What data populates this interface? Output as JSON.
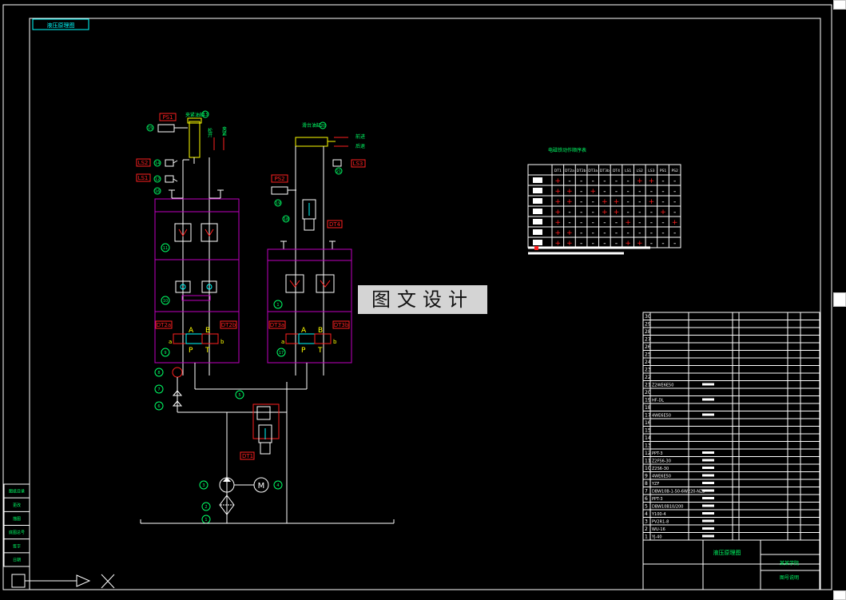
{
  "title_box": "液压原理图",
  "cylinders": {
    "left_title": "夹紧油缸",
    "right_title": "滑台油缸",
    "left_dir_labels": [
      "松开",
      "夹紧"
    ],
    "right_dir_labels": [
      "前进",
      "后退"
    ]
  },
  "tags": {
    "ps1": "PS1",
    "ps2": "PS2",
    "ls1": "LS1",
    "ls2": "LS2",
    "ls3": "LS3",
    "dt1": "DT1",
    "dt2a": "DT2a",
    "dt2b": "DT2b",
    "dt3a": "DT3a",
    "dt3b": "DT3b",
    "dt4": "DT4"
  },
  "valve_ports": {
    "left": {
      "a": "A",
      "b": "B",
      "p": "P",
      "t": "T",
      "sa": "a",
      "sb": "b"
    },
    "right": {
      "a": "A",
      "b": "B",
      "p": "P",
      "t": "T",
      "sa": "a",
      "sb": "b"
    }
  },
  "callouts": {
    "n1": "1",
    "n2": "2",
    "n3": "3",
    "n4": "4",
    "n5": "5",
    "n6": "6",
    "n7": "7",
    "n8": "8",
    "n9": "9",
    "n10": "10",
    "n11": "11",
    "n12": "12",
    "n13": "13",
    "n14": "14",
    "n15": "15",
    "n16": "16",
    "n17": "17",
    "n18": "18",
    "n19": "19",
    "n20": "20",
    "n21": "21"
  },
  "motor_symbol": "M",
  "action_table": {
    "title": "电磁铁动作顺序表",
    "headers": [
      "DT1",
      "DT2a",
      "DT2b",
      "DT3a",
      "DT3b",
      "DT4",
      "LS1",
      "LS2",
      "LS3",
      "PS1",
      "PS2"
    ],
    "rows": [
      [
        "+",
        "-",
        "-",
        "-",
        "-",
        "-",
        "-",
        "+",
        "+",
        "-",
        "-"
      ],
      [
        "+",
        "+",
        "-",
        "+",
        "-",
        "-",
        "-",
        "-",
        "-",
        "-",
        "-"
      ],
      [
        "+",
        "+",
        "-",
        "-",
        "+",
        "+",
        "-",
        "-",
        "+",
        "-",
        "-"
      ],
      [
        "+",
        "-",
        "-",
        "-",
        "+",
        "+",
        "-",
        "-",
        "-",
        "+",
        "-"
      ],
      [
        "+",
        "-",
        "-",
        "-",
        "-",
        "-",
        "+",
        "-",
        "-",
        "-",
        "+"
      ],
      [
        "+",
        "+",
        "-",
        "-",
        "-",
        "-",
        "-",
        "-",
        "-",
        "-",
        "-"
      ],
      [
        "+",
        "+",
        "-",
        "-",
        "-",
        "-",
        "+",
        "+",
        "-",
        "-",
        "-"
      ]
    ]
  },
  "watermark": "图文设计",
  "bom": [
    {
      "n": "30",
      "name": ""
    },
    {
      "n": "29",
      "name": ""
    },
    {
      "n": "28",
      "name": ""
    },
    {
      "n": "27",
      "name": ""
    },
    {
      "n": "26",
      "name": ""
    },
    {
      "n": "25",
      "name": ""
    },
    {
      "n": "24",
      "name": ""
    },
    {
      "n": "23",
      "name": ""
    },
    {
      "n": "22",
      "name": ""
    },
    {
      "n": "21",
      "name": "Z2WE6E50"
    },
    {
      "n": "20",
      "name": ""
    },
    {
      "n": "19",
      "name": "HF-DL"
    },
    {
      "n": "18",
      "name": ""
    },
    {
      "n": "17",
      "name": "4WE6E50"
    },
    {
      "n": "16",
      "name": ""
    },
    {
      "n": "15",
      "name": ""
    },
    {
      "n": "14",
      "name": ""
    },
    {
      "n": "13",
      "name": ""
    },
    {
      "n": "12",
      "name": "PPT-3"
    },
    {
      "n": "11",
      "name": "Z2FS6-30"
    },
    {
      "n": "10",
      "name": "Z2S6-30"
    },
    {
      "n": "9",
      "name": "4WE6E50"
    },
    {
      "n": "8",
      "name": "YZF"
    },
    {
      "n": "7",
      "name": "DBW10B-1-50-6W220-NZ5"
    },
    {
      "n": "6",
      "name": "PPT-3"
    },
    {
      "n": "5",
      "name": "DBW10B10/200"
    },
    {
      "n": "4",
      "name": "Y100-4"
    },
    {
      "n": "3",
      "name": "PV2R1-8"
    },
    {
      "n": "2",
      "name": "WU-16"
    },
    {
      "n": "1",
      "name": "YJ-40"
    }
  ],
  "title_block": {
    "drawing_name": "液压原理图",
    "company": "某某学院",
    "sheet_code": "图号说明"
  },
  "side_strip": [
    "图纸目录",
    "更改",
    "描图",
    "底图总号",
    "签字",
    "日期"
  ],
  "colors": {
    "background": "#000000",
    "frame": "#ffffff",
    "valve_block": "#c000c0",
    "tag": "#ff2020",
    "label": "#00ff66",
    "port": "#ffff00",
    "flow": "#00ffff"
  }
}
